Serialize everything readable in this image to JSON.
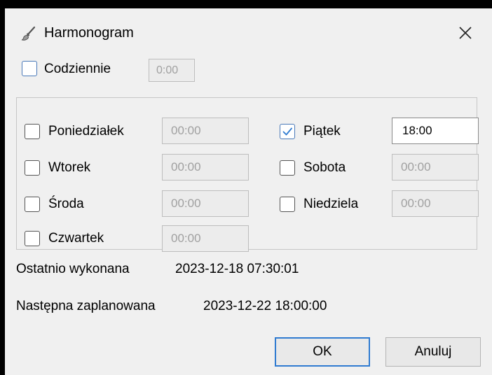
{
  "window": {
    "title": "Harmonogram"
  },
  "daily": {
    "label": "Codziennie",
    "checked": false,
    "time": "0:00"
  },
  "days": [
    {
      "label": "Poniedziałek",
      "checked": false,
      "time": "00:00"
    },
    {
      "label": "Wtorek",
      "checked": false,
      "time": "00:00"
    },
    {
      "label": "Środa",
      "checked": false,
      "time": "00:00"
    },
    {
      "label": "Czwartek",
      "checked": false,
      "time": "00:00"
    },
    {
      "label": "Piątek",
      "checked": true,
      "time": "18:00"
    },
    {
      "label": "Sobota",
      "checked": false,
      "time": "00:00"
    },
    {
      "label": "Niedziela",
      "checked": false,
      "time": "00:00"
    }
  ],
  "last_run": {
    "label": "Ostatnio wykonana",
    "value": "2023-12-18 07:30:01"
  },
  "next_run": {
    "label": "Następna zaplanowana",
    "value": "2023-12-22 18:00:00"
  },
  "buttons": {
    "ok": "OK",
    "cancel": "Anuluj"
  },
  "colors": {
    "accent": "#2f7bd1",
    "checkbox_border": "#4a79b8",
    "window_bg": "#f0f0f0"
  },
  "icons": {
    "app": "brush-icon",
    "close": "close-icon",
    "check": "checkmark-icon"
  }
}
